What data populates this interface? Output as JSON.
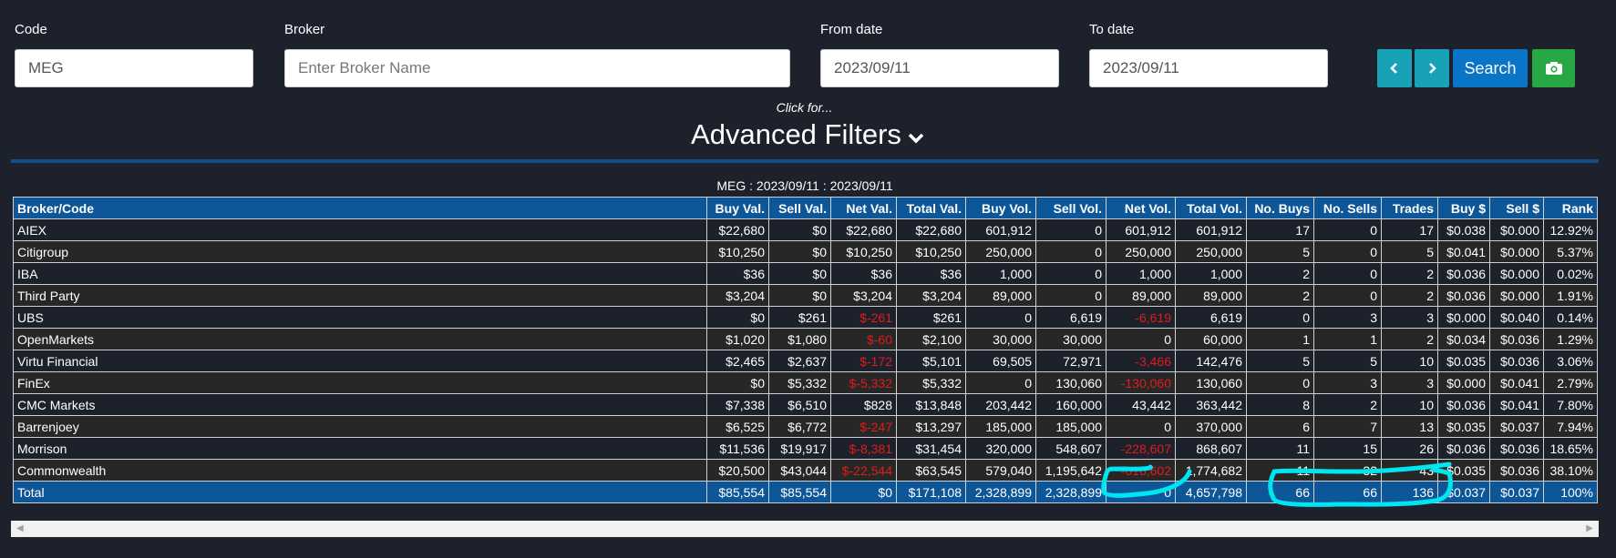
{
  "filters": {
    "code": {
      "label": "Code",
      "value": "MEG",
      "placeholder": ""
    },
    "broker": {
      "label": "Broker",
      "value": "",
      "placeholder": "Enter Broker Name"
    },
    "from_date": {
      "label": "From date",
      "value": "2023/09/11"
    },
    "to_date": {
      "label": "To date",
      "value": "2023/09/11"
    }
  },
  "buttons": {
    "prev_icon": "chevron-left-icon",
    "next_icon": "chevron-right-icon",
    "search_label": "Search",
    "camera_icon": "camera-icon"
  },
  "advanced": {
    "hint": "Click for...",
    "title": "Advanced Filters"
  },
  "table": {
    "caption": "MEG : 2023/09/11 : 2023/09/11",
    "columns": [
      "Broker/Code",
      "Buy Val.",
      "Sell Val.",
      "Net Val.",
      "Total Val.",
      "Buy Vol.",
      "Sell Vol.",
      "Net Vol.",
      "Total Vol.",
      "No. Buys",
      "No. Sells",
      "Trades",
      "Buy $",
      "Sell $",
      "Rank"
    ],
    "rows": [
      [
        "AIEX",
        "$22,680",
        "$0",
        "$22,680",
        "$22,680",
        "601,912",
        "0",
        "601,912",
        "601,912",
        "17",
        "0",
        "17",
        "$0.038",
        "$0.000",
        "12.92%"
      ],
      [
        "Citigroup",
        "$10,250",
        "$0",
        "$10,250",
        "$10,250",
        "250,000",
        "0",
        "250,000",
        "250,000",
        "5",
        "0",
        "5",
        "$0.041",
        "$0.000",
        "5.37%"
      ],
      [
        "IBA",
        "$36",
        "$0",
        "$36",
        "$36",
        "1,000",
        "0",
        "1,000",
        "1,000",
        "2",
        "0",
        "2",
        "$0.036",
        "$0.000",
        "0.02%"
      ],
      [
        "Third Party",
        "$3,204",
        "$0",
        "$3,204",
        "$3,204",
        "89,000",
        "0",
        "89,000",
        "89,000",
        "2",
        "0",
        "2",
        "$0.036",
        "$0.000",
        "1.91%"
      ],
      [
        "UBS",
        "$0",
        "$261",
        "$-261",
        "$261",
        "0",
        "6,619",
        "-6,619",
        "6,619",
        "0",
        "3",
        "3",
        "$0.000",
        "$0.040",
        "0.14%"
      ],
      [
        "OpenMarkets",
        "$1,020",
        "$1,080",
        "$-60",
        "$2,100",
        "30,000",
        "30,000",
        "0",
        "60,000",
        "1",
        "1",
        "2",
        "$0.034",
        "$0.036",
        "1.29%"
      ],
      [
        "Virtu Financial",
        "$2,465",
        "$2,637",
        "$-172",
        "$5,101",
        "69,505",
        "72,971",
        "-3,466",
        "142,476",
        "5",
        "5",
        "10",
        "$0.035",
        "$0.036",
        "3.06%"
      ],
      [
        "FinEx",
        "$0",
        "$5,332",
        "$-5,332",
        "$5,332",
        "0",
        "130,060",
        "-130,060",
        "130,060",
        "0",
        "3",
        "3",
        "$0.000",
        "$0.041",
        "2.79%"
      ],
      [
        "CMC Markets",
        "$7,338",
        "$6,510",
        "$828",
        "$13,848",
        "203,442",
        "160,000",
        "43,442",
        "363,442",
        "8",
        "2",
        "10",
        "$0.036",
        "$0.041",
        "7.80%"
      ],
      [
        "Barrenjoey",
        "$6,525",
        "$6,772",
        "$-247",
        "$13,297",
        "185,000",
        "185,000",
        "0",
        "370,000",
        "6",
        "7",
        "13",
        "$0.035",
        "$0.037",
        "7.94%"
      ],
      [
        "Morrison",
        "$11,536",
        "$19,917",
        "$-8,381",
        "$31,454",
        "320,000",
        "548,607",
        "-228,607",
        "868,607",
        "11",
        "15",
        "26",
        "$0.036",
        "$0.036",
        "18.65%"
      ],
      [
        "Commonwealth",
        "$20,500",
        "$43,044",
        "$-22,544",
        "$63,545",
        "579,040",
        "1,195,642",
        "-616,602",
        "1,774,682",
        "11",
        "32",
        "43",
        "$0.035",
        "$0.036",
        "38.10%"
      ]
    ],
    "total": [
      "Total",
      "$85,554",
      "$85,554",
      "$0",
      "$171,108",
      "2,328,899",
      "2,328,899",
      "0",
      "4,657,798",
      "66",
      "66",
      "136",
      "$0.037",
      "$0.037",
      "100%"
    ]
  },
  "colors": {
    "background": "#1c212b",
    "header": "#0d5799",
    "negative": "#e21b1b",
    "annotation": "#00e5f0",
    "search_button": "#0a74c6",
    "nav_button": "#17a2b8",
    "camera_button": "#28a745"
  }
}
